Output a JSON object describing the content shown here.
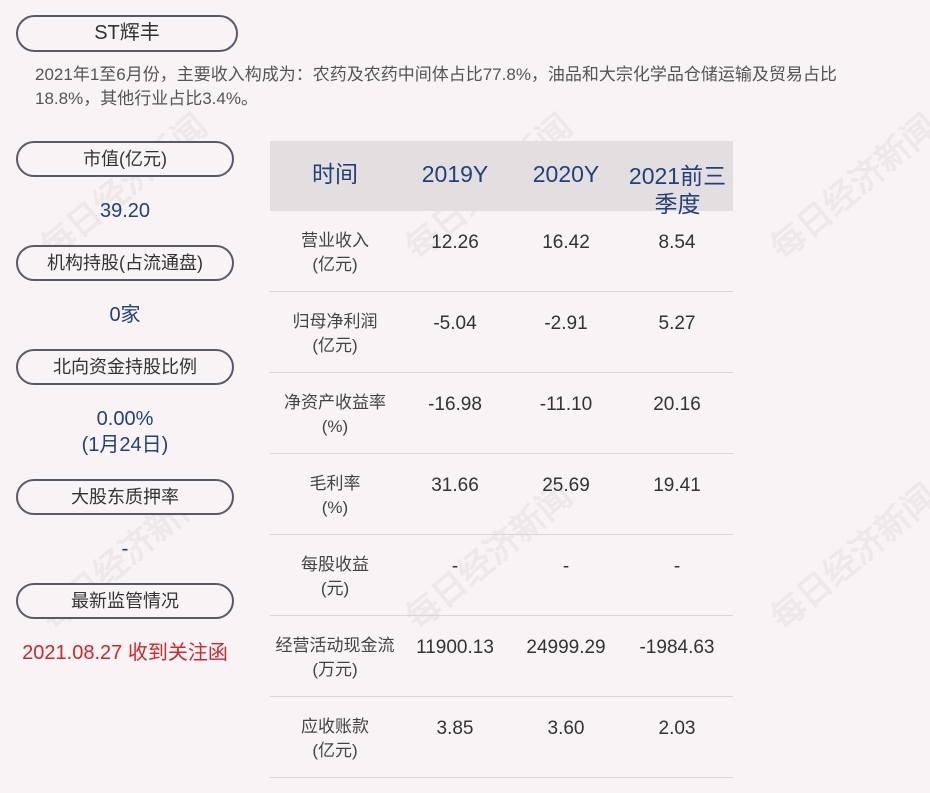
{
  "title": "ST辉丰",
  "intro": "2021年1至6月份，主要收入构成为：农药及农药中间体占比77.8%，油品和大宗化学品仓储运输及贸易占比18.8%，其他行业占比3.4%。",
  "side": {
    "market_cap_label": "市值(亿元)",
    "market_cap_value": "39.20",
    "inst_label": "机构持股(占流通盘)",
    "inst_value": "0家",
    "north_label": "北向资金持股比例",
    "north_value": "0.00%",
    "north_date": "(1月24日)",
    "pledge_label": "大股东质押率",
    "pledge_value": "-",
    "reg_label": "最新监管情况",
    "reg_value": "2021.08.27 收到关注函"
  },
  "table": {
    "headers": [
      "时间",
      "2019Y",
      "2020Y",
      "2021前三季度"
    ],
    "rows": [
      {
        "label": "营业收入",
        "unit": "(亿元)",
        "values": [
          "12.26",
          "16.42",
          "8.54"
        ]
      },
      {
        "label": "归母净利润",
        "unit": "(亿元)",
        "values": [
          "-5.04",
          "-2.91",
          "5.27"
        ]
      },
      {
        "label": "净资产收益率",
        "unit": "(%)",
        "values": [
          "-16.98",
          "-11.10",
          "20.16"
        ]
      },
      {
        "label": "毛利率",
        "unit": "(%)",
        "values": [
          "31.66",
          "25.69",
          "19.41"
        ]
      },
      {
        "label": "每股收益",
        "unit": "(元)",
        "values": [
          "-",
          "-",
          "-"
        ]
      },
      {
        "label": "经营活动现金流",
        "unit": "(万元)",
        "values": [
          "11900.13",
          "24999.29",
          "-1984.63"
        ]
      },
      {
        "label": "应收账款",
        "unit": "(亿元)",
        "values": [
          "3.85",
          "3.60",
          "2.03"
        ]
      }
    ]
  },
  "watermark": "每日经济新闻"
}
